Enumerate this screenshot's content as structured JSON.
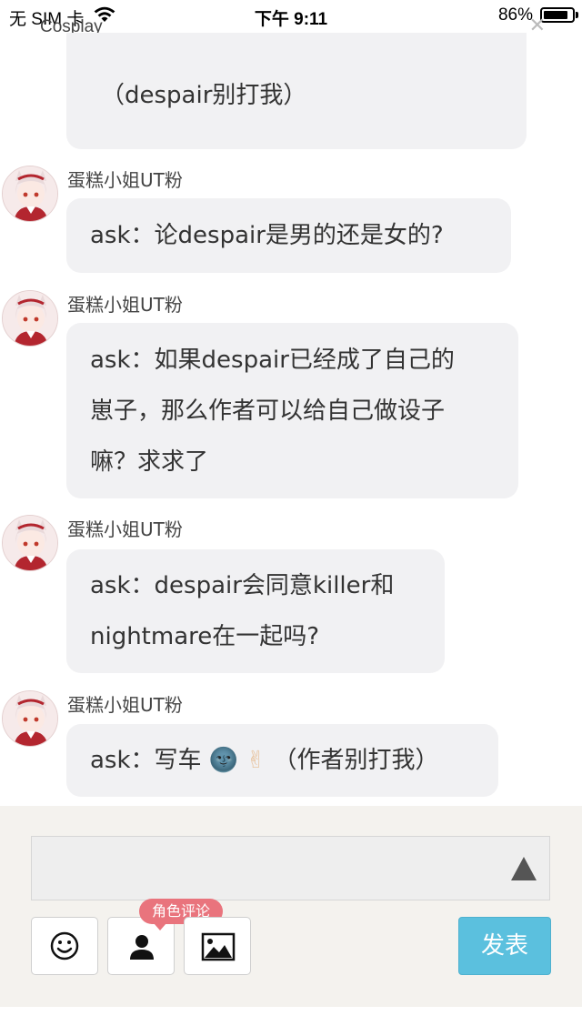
{
  "status_bar": {
    "carrier": "无 SIM 卡",
    "time": "下午 9:11",
    "battery": "86%",
    "battery_level": 0.86
  },
  "header": {
    "title": "Cosplay",
    "close_glyph": "✕"
  },
  "messages": [
    {
      "user": "",
      "text": "（despair别打我）"
    },
    {
      "user": "蛋糕小姐UT粉",
      "text": "ask：论despair是男的还是女的?"
    },
    {
      "user": "蛋糕小姐UT粉",
      "line1": "ask：如果despair已经成了自己的",
      "line2": "崽子，那么作者可以给自己做设子",
      "line3": "嘛？求求了"
    },
    {
      "user": "蛋糕小姐UT粉",
      "line1": "ask：despair会同意killer和",
      "line2": "nightmare在一起吗?"
    },
    {
      "user": "蛋糕小姐UT粉",
      "prefix": "ask：写车",
      "emoji1": "🌚",
      "emoji2": "✌",
      "suffix": "（作者别打我）"
    }
  ],
  "composer": {
    "input_value": "",
    "badge": "角色评论",
    "send_label": "发表",
    "icons": [
      "smiley-icon",
      "person-icon",
      "image-icon"
    ]
  },
  "colors": {
    "bubble": "#f1f1f3",
    "send": "#5bc0de",
    "badge": "#e9747d",
    "panel": "#f4f2ee"
  }
}
